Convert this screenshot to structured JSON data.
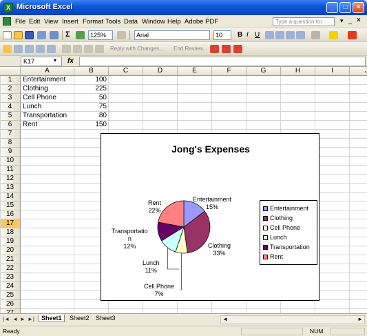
{
  "window": {
    "title": "Microsoft Excel",
    "app_icon": "excel-icon",
    "controls": {
      "minimize": "_",
      "maximize": "□",
      "close": "×"
    }
  },
  "menu": {
    "items": [
      "File",
      "Edit",
      "View",
      "Insert",
      "Format",
      "Tools",
      "Data",
      "Window",
      "Help",
      "Adobe PDF"
    ],
    "help_placeholder": "Type a question for help"
  },
  "toolbar": {
    "zoom": "125%",
    "font_name": "Arial",
    "font_size": "10",
    "bold_label": "B",
    "italic_label": "I",
    "underline_label": "U",
    "review_reply": "Reply with Changes...",
    "review_end": "End Review..."
  },
  "formula_bar": {
    "cell_ref": "K17",
    "fx": "fx",
    "value": ""
  },
  "columns": [
    "A",
    "B",
    "C",
    "D",
    "E",
    "F",
    "G",
    "H",
    "I",
    "J"
  ],
  "rows": [
    "1",
    "2",
    "3",
    "4",
    "5",
    "6",
    "7",
    "8",
    "9",
    "10",
    "11",
    "12",
    "13",
    "14",
    "15",
    "16",
    "17",
    "18",
    "19",
    "20",
    "21",
    "22",
    "23",
    "24",
    "25",
    "26",
    "27"
  ],
  "selected_row": "17",
  "cells": [
    {
      "label": "Entertainment",
      "value": "100"
    },
    {
      "label": "Clothing",
      "value": "225"
    },
    {
      "label": "Cell Phone",
      "value": "50"
    },
    {
      "label": "Lunch",
      "value": "75"
    },
    {
      "label": "Transportation",
      "value": "80"
    },
    {
      "label": "Rent",
      "value": "150"
    }
  ],
  "chart_data": {
    "type": "pie",
    "title": "Jong's Expenses",
    "categories": [
      "Entertainment",
      "Clothing",
      "Cell Phone",
      "Lunch",
      "Transportation",
      "Rent"
    ],
    "values": [
      100,
      225,
      50,
      75,
      80,
      150
    ],
    "percent_labels": [
      "15%",
      "33%",
      "7%",
      "11%",
      "12%",
      "22%"
    ],
    "colors": [
      "#9999ff",
      "#993366",
      "#ffffcc",
      "#ccffff",
      "#660066",
      "#ff8080"
    ],
    "slice_labels": {
      "entertainment": [
        "Entertainment",
        "15%"
      ],
      "clothing": [
        "Clothing",
        "33%"
      ],
      "cell_phone": [
        "Cell Phone",
        "7%"
      ],
      "lunch": [
        "Lunch",
        "11%"
      ],
      "transportation": [
        "Transportatio",
        "n",
        "12%"
      ],
      "rent": [
        "Rent",
        "22%"
      ]
    },
    "legend": [
      "Entertainment",
      "Clothing",
      "Cell Phone",
      "Lunch",
      "Transportation",
      "Rent"
    ],
    "legend_placement": "right"
  },
  "sheet_tabs": [
    "Sheet1",
    "Sheet2",
    "Sheet3"
  ],
  "active_sheet": "Sheet1",
  "status": {
    "left": "Ready",
    "num": "NUM"
  }
}
